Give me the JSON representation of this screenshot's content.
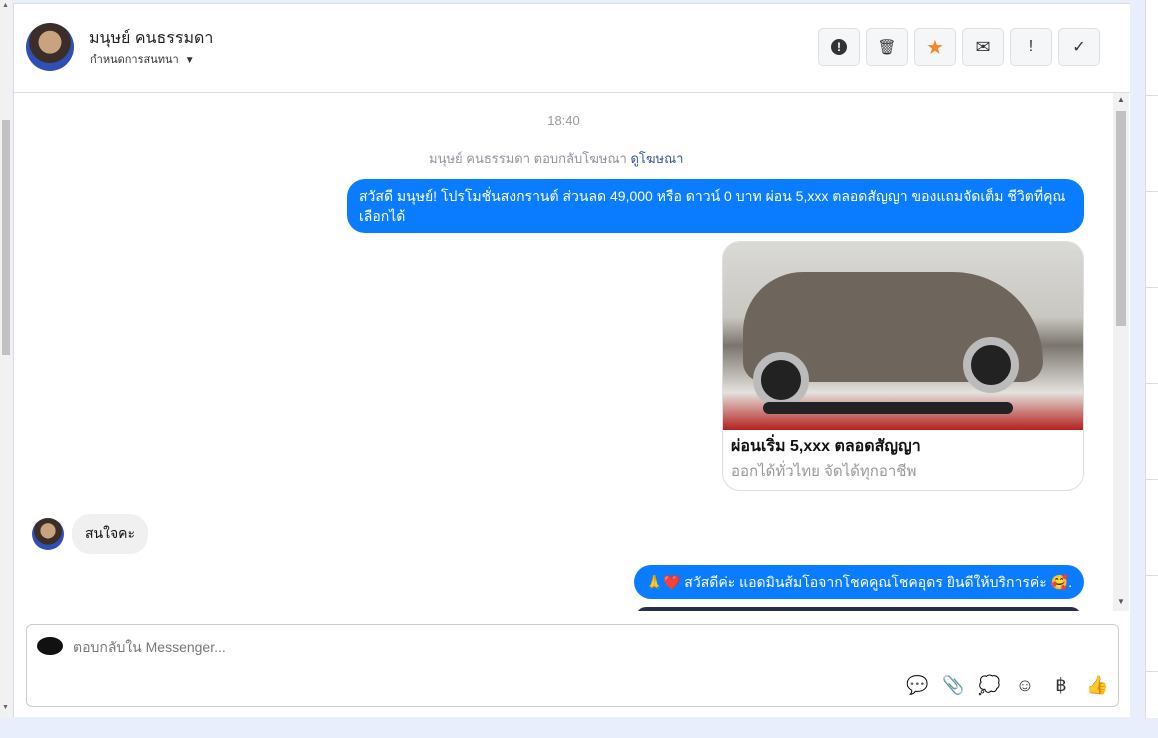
{
  "header": {
    "name": "มนุษย์ คนธรรมดา",
    "subtitle": "กำหนดการสนทนา",
    "actions": [
      {
        "icon": "alert-circle-icon",
        "glyph": "❗"
      },
      {
        "icon": "trash-icon",
        "glyph": "🗑"
      },
      {
        "icon": "star-icon",
        "glyph": "★"
      },
      {
        "icon": "envelope-icon",
        "glyph": "✉"
      },
      {
        "icon": "exclamation-icon",
        "glyph": "!"
      },
      {
        "icon": "check-icon",
        "glyph": "✓"
      }
    ]
  },
  "chat": {
    "time": "18:40",
    "note": "มนุษย์ คนธรรมดา ตอบกลับโฆษณา",
    "note_link": "ดูโฆษณา",
    "msg1": "สวัสดี มนุษย์! โปรโมชั่นสงกรานต์ ส่วนลด 49,000 หรือ ดาวน์ 0 บาท ผ่อน 5,xxx ตลอดสัญญา ของแถมจัดเต็ม ชีวิตที่คุณเลือกได้",
    "card_title": "ผ่อนเริ่ม 5,xxx ตลอดสัญญา",
    "card_subtitle": "ออกได้ทั่วไทย จัดได้ทุกอาชีพ",
    "msg2": "สนใจคะ",
    "msg3": "🙏❤️ สวัสดีค่ะ แอดมินส้มโอจากโชคคูณโชคอุดร ยินดีให้บริการค่ะ 🥰."
  },
  "composer": {
    "placeholder": "ตอบกลับใน Messenger...",
    "tools": [
      {
        "icon": "saved-reply-icon",
        "glyph": "💬"
      },
      {
        "icon": "attachment-icon",
        "glyph": "📎"
      },
      {
        "icon": "chat-dots-icon",
        "glyph": "💭"
      },
      {
        "icon": "emoji-icon",
        "glyph": "☺"
      },
      {
        "icon": "baht-icon",
        "glyph": "฿"
      },
      {
        "icon": "thumbs-up-icon",
        "glyph": "👍"
      }
    ]
  },
  "colors": {
    "accent": "#0a7cff",
    "star": "#f5882a"
  }
}
